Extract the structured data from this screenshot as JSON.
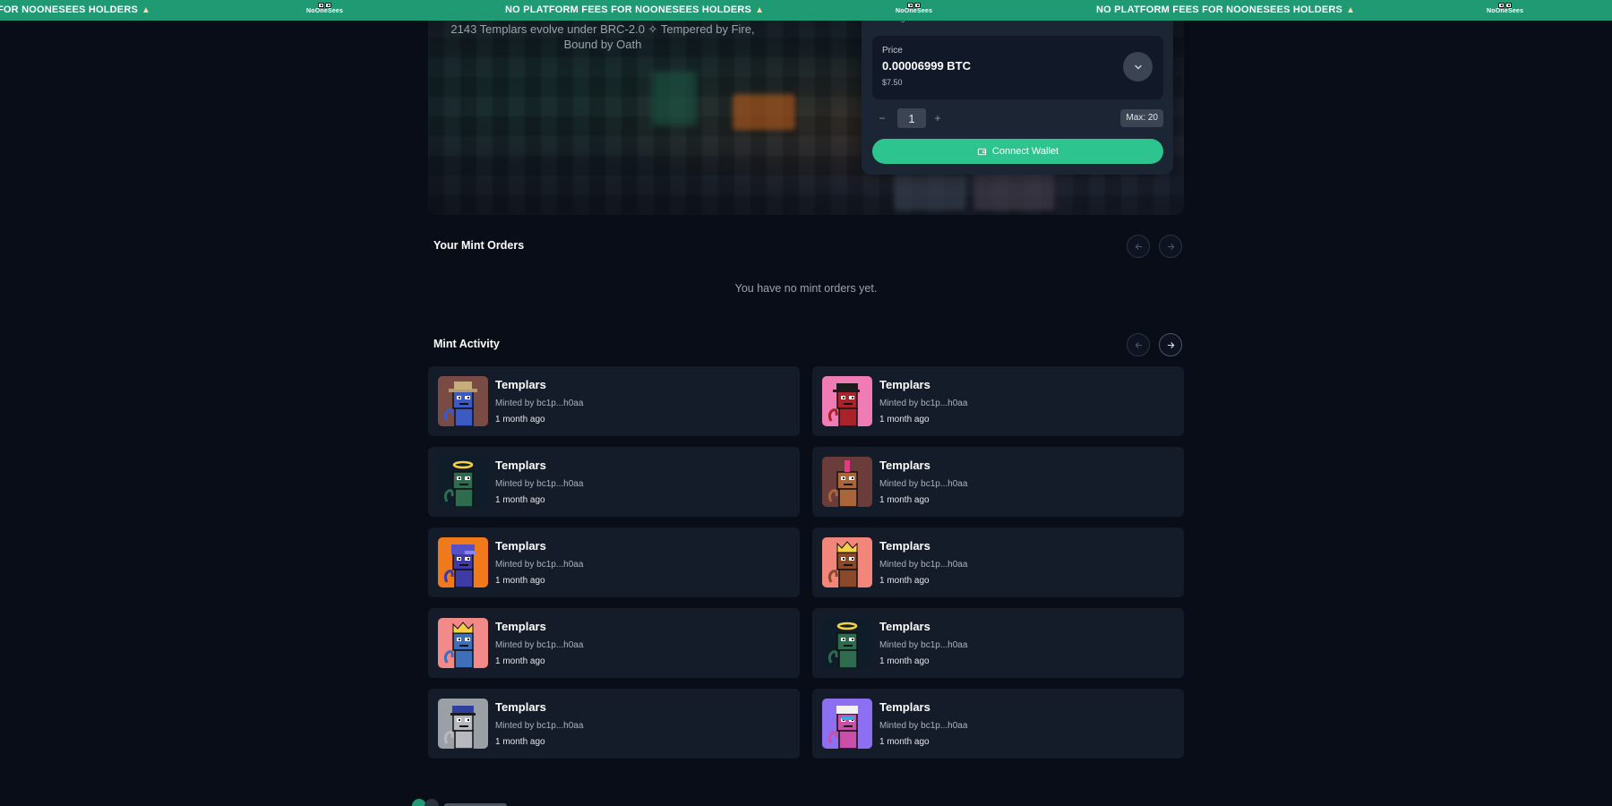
{
  "banner": {
    "message": "NO PLATFORM FEES FOR NOONESEES HOLDERS",
    "message_cut": "FOR NOONESEES HOLDERS",
    "logo_text": "NoOneSees",
    "flame_icon": "flame-icon",
    "color": "#1f9a72"
  },
  "hero": {
    "description": "2143 Templars evolve under BRC-2.0",
    "description_tail": "Tempered by Fire, Bound by Oath",
    "spark_icon": "sparkle-icon"
  },
  "mint_card": {
    "cut_label": "Pending",
    "price_label": "Price",
    "price_value": "0.00006999 BTC",
    "price_usd": "$7.50",
    "quantity": "1",
    "minus": "−",
    "plus": "+",
    "max_label": "Max: 20",
    "connect_label": "Connect Wallet",
    "accent": "#2ec48f"
  },
  "orders": {
    "title": "Your Mint Orders",
    "empty_text": "You have no mint orders yet."
  },
  "activity": {
    "title": "Mint Activity",
    "items": [
      {
        "name": "Templars",
        "minted_by": "Minted by bc1p...h0aa",
        "time": "1 month ago",
        "bg": "#7a4b45",
        "skin": "#3d5ac4",
        "hat": "cowboy-hat"
      },
      {
        "name": "Templars",
        "minted_by": "Minted by bc1p...h0aa",
        "time": "1 month ago",
        "bg": "#ef7cb5",
        "skin": "#a8242a",
        "hat": "black-cap"
      },
      {
        "name": "Templars",
        "minted_by": "Minted by bc1p...h0aa",
        "time": "1 month ago",
        "bg": "#0f1d2a",
        "skin": "#2e6b4f",
        "hat": "halo"
      },
      {
        "name": "Templars",
        "minted_by": "Minted by bc1p...h0aa",
        "time": "1 month ago",
        "bg": "#6b3d3a",
        "skin": "#a8663a",
        "hat": "mohawk"
      },
      {
        "name": "Templars",
        "minted_by": "Minted by bc1p...h0aa",
        "time": "1 month ago",
        "bg": "#f07a1a",
        "skin": "#3e3aa6",
        "hat": "helmet"
      },
      {
        "name": "Templars",
        "minted_by": "Minted by bc1p...h0aa",
        "time": "1 month ago",
        "bg": "#f2867a",
        "skin": "#8a4a2a",
        "hat": "crown"
      },
      {
        "name": "Templars",
        "minted_by": "Minted by bc1p...h0aa",
        "time": "1 month ago",
        "bg": "#f28a8a",
        "skin": "#3e6fb8",
        "hat": "crown"
      },
      {
        "name": "Templars",
        "minted_by": "Minted by bc1p...h0aa",
        "time": "1 month ago",
        "bg": "#0f1d2a",
        "skin": "#2e6b4f",
        "hat": "halo"
      },
      {
        "name": "Templars",
        "minted_by": "Minted by bc1p...h0aa",
        "time": "1 month ago",
        "bg": "#9aa0a6",
        "skin": "#b8b8c0",
        "hat": "police-cap"
      },
      {
        "name": "Templars",
        "minted_by": "Minted by bc1p...h0aa",
        "time": "1 month ago",
        "bg": "#8d6ff2",
        "skin": "#c94fa8",
        "hat": "white-cap"
      }
    ]
  }
}
